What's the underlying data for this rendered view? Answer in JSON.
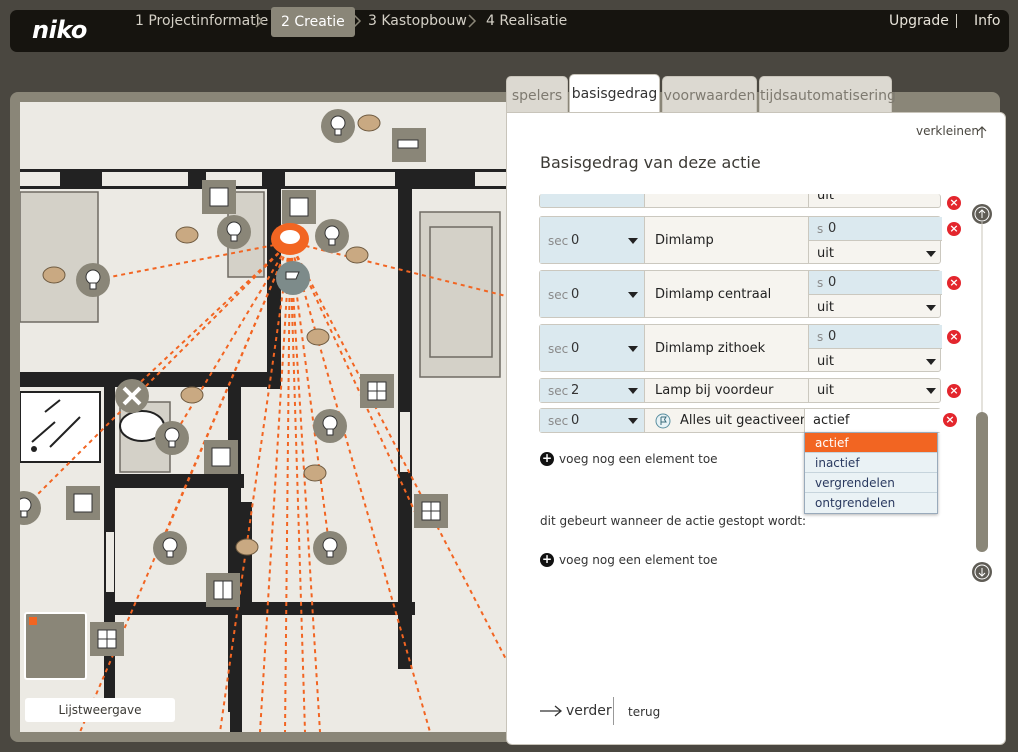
{
  "nav": {
    "logo": "niko",
    "steps": [
      "1 Projectinformatie",
      "2 Creatie",
      "3 Kastopbouw",
      "4 Realisatie"
    ],
    "upgrade": "Upgrade",
    "info": "Info"
  },
  "tabs": [
    "spelers",
    "basisgedrag",
    "voorwaarden",
    "tijdsautomatisering"
  ],
  "panel": {
    "shrink": "verkleinen",
    "title": "Basisgedrag van deze actie",
    "rows": [
      {
        "sec": "0",
        "name": "Dimlamp",
        "s": "0",
        "value": "uit"
      },
      {
        "sec": "0",
        "name": "Dimlamp centraal",
        "s": "0",
        "value": "uit"
      },
      {
        "sec": "0",
        "name": "Dimlamp zithoek",
        "s": "0",
        "value": "uit"
      },
      {
        "sec": "2",
        "name": "Lamp bij voordeur",
        "value": "uit"
      },
      {
        "sec": "0",
        "name": "Alles uit geactiveerd?",
        "value": "actief"
      }
    ],
    "sec_label": "sec",
    "s_label": "s",
    "dropdown": [
      "actief",
      "inactief",
      "vergrendelen",
      "ontgrendelen"
    ],
    "add_element": "voeg nog een element toe",
    "stop_text": "dit gebeurt wanneer de actie gestopt wordt:",
    "add_element_2": "voeg nog een element toe",
    "next": "verder",
    "back": "terug"
  },
  "map": {
    "list_view": "Lijstweergave"
  },
  "colors": {
    "accent": "#f26522",
    "delete": "#e3262d",
    "field_blue": "#dbe9ef"
  }
}
